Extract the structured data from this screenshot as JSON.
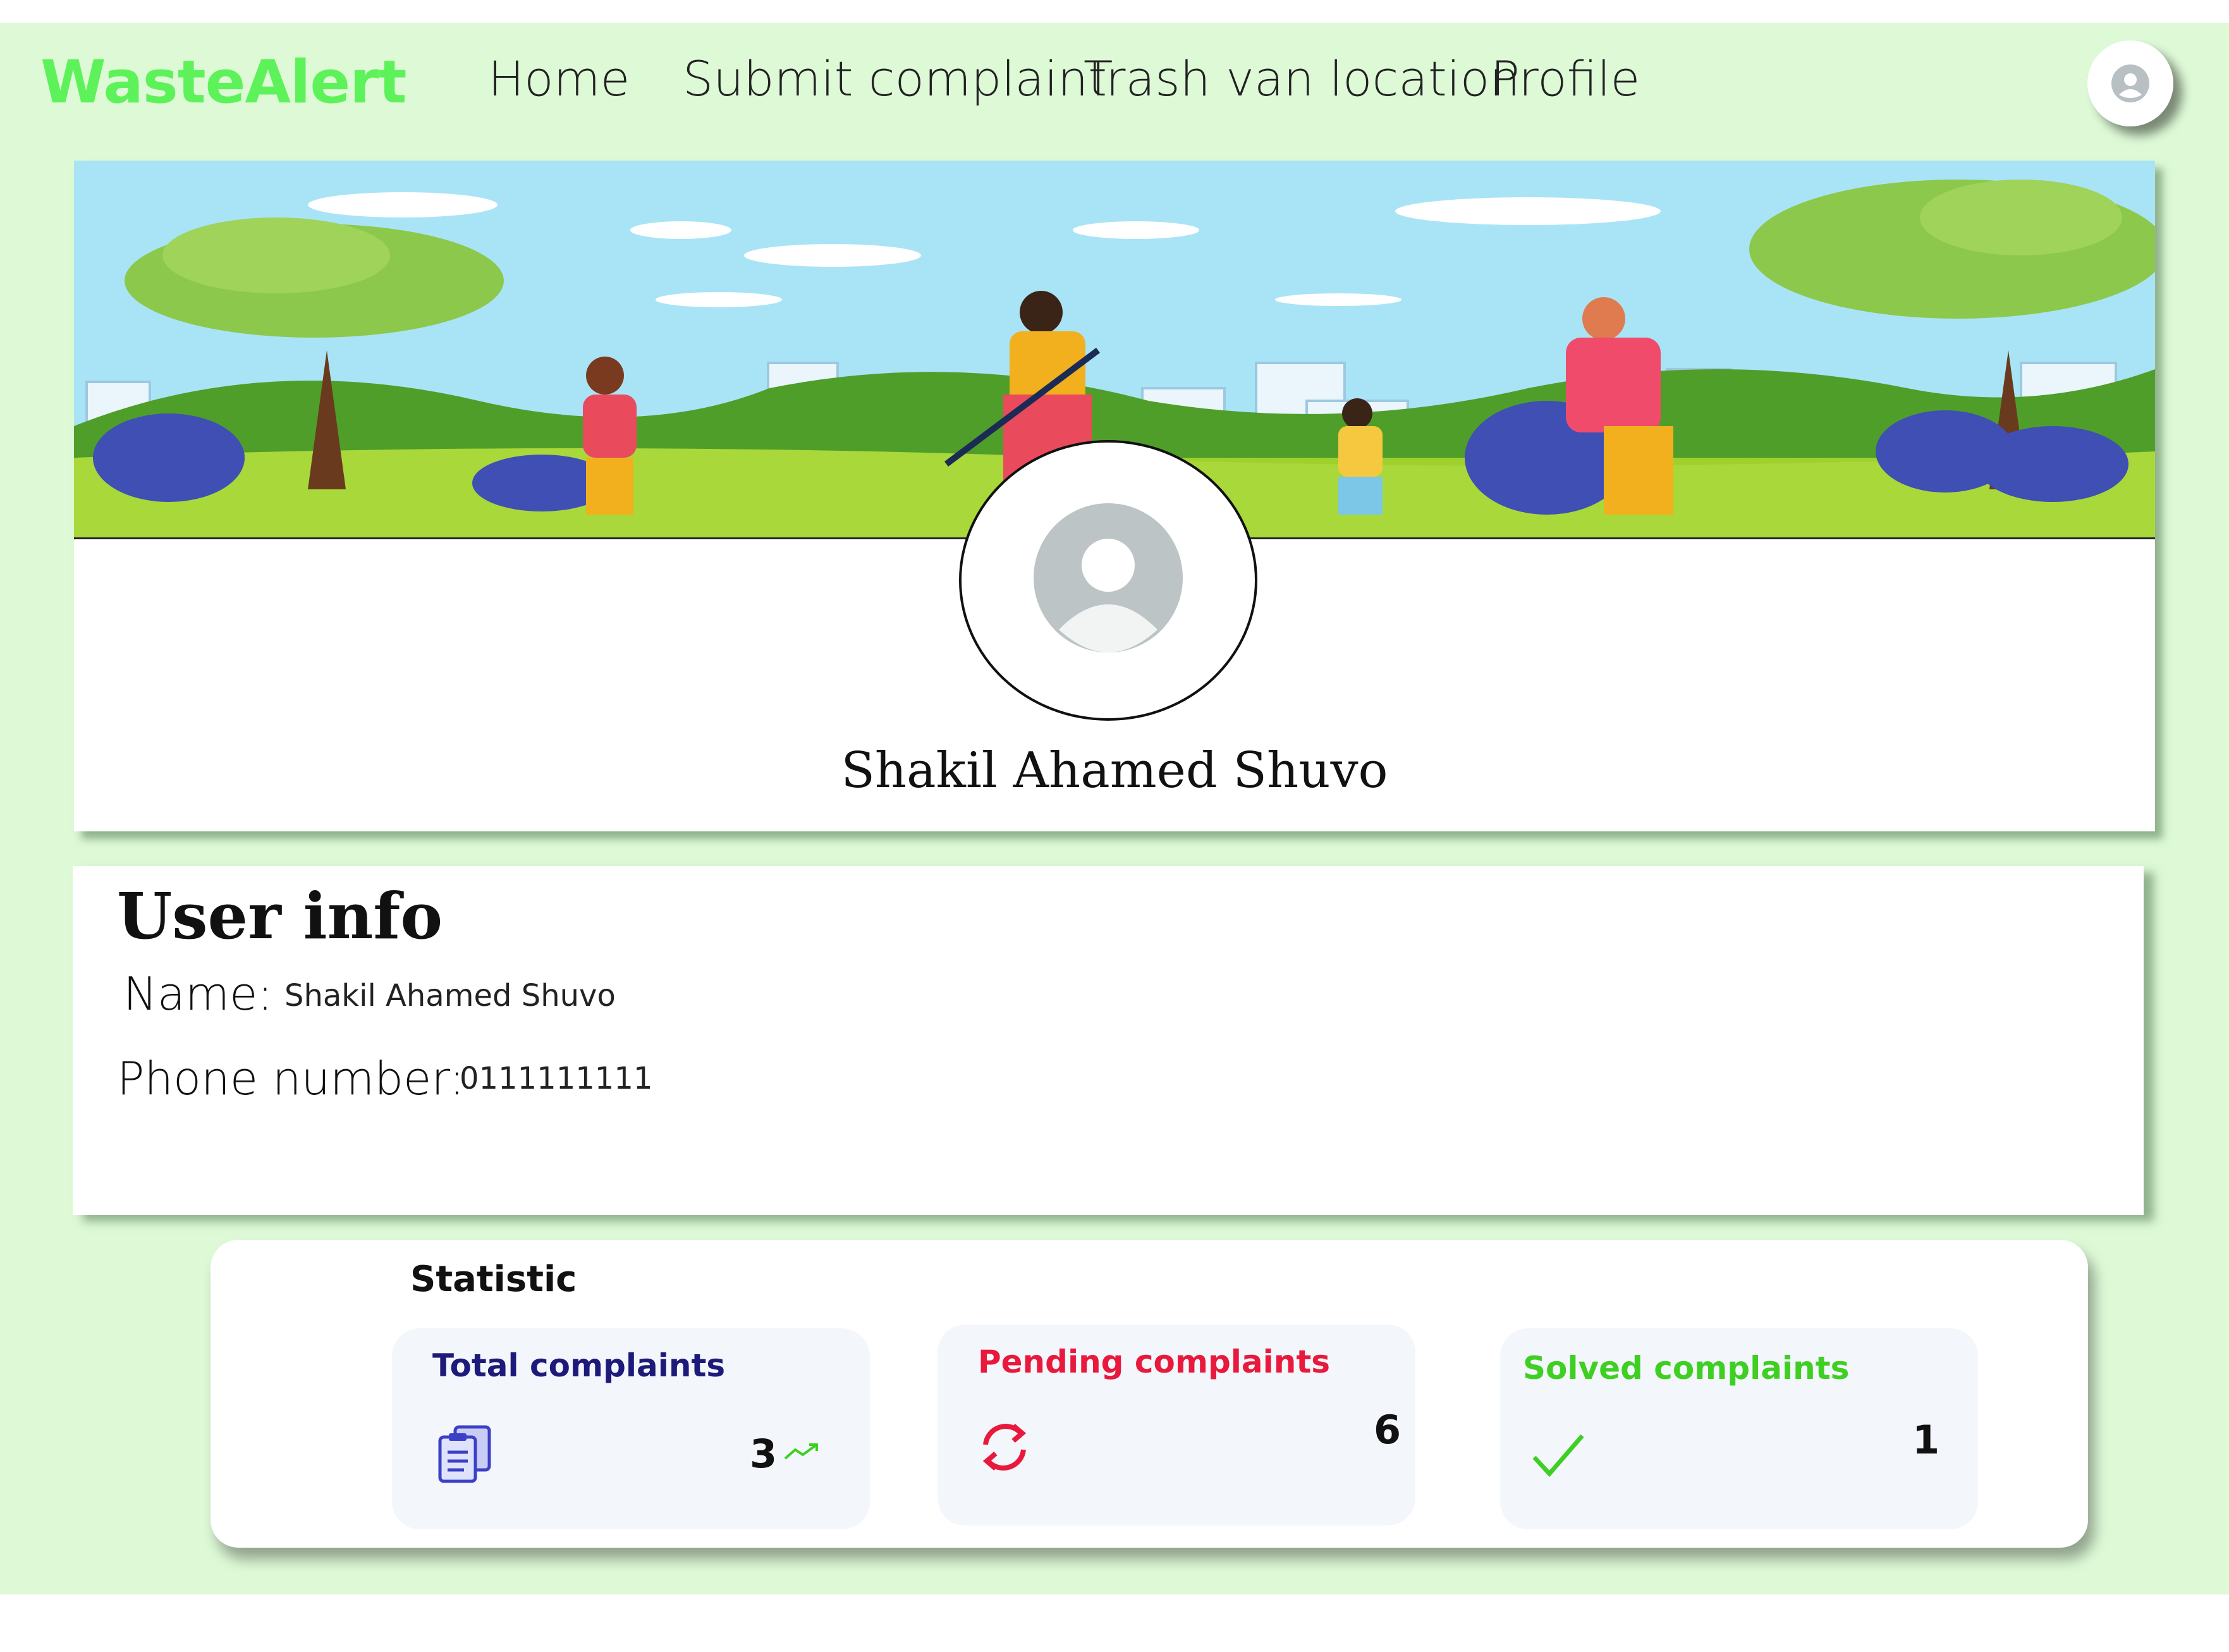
{
  "header": {
    "brand": "WasteAlert",
    "nav": [
      {
        "label": "Home"
      },
      {
        "label": "Submit complaint"
      },
      {
        "label": "Trash van location"
      },
      {
        "label": "Profile"
      }
    ],
    "user_avatar_icon": "user-avatar-icon"
  },
  "profile": {
    "banner_icon": "community-cleanup-illustration",
    "avatar_icon": "default-avatar-icon",
    "name": "Shakil Ahamed Shuvo"
  },
  "user_info": {
    "title": "User info",
    "name_label": "Name:",
    "name_value": "Shakil Ahamed Shuvo",
    "phone_label": "Phone number:",
    "phone_value": "0111111111"
  },
  "statistic": {
    "title": "Statistic",
    "cards": [
      {
        "label": "Total complaints",
        "count": "3",
        "icon": "clipboard-icon",
        "trend_icon": "trending-up-icon",
        "color": "#1d1a7a"
      },
      {
        "label": "Pending complaints",
        "count": "6",
        "icon": "refresh-icon",
        "color": "#e8193c"
      },
      {
        "label": "Solved complaints",
        "count": "1",
        "icon": "check-icon",
        "color": "#3fcf23"
      }
    ]
  },
  "colors": {
    "background": "#ddf9d6",
    "brand": "#5ef25a",
    "total": "#1d1a7a",
    "pending": "#e8193c",
    "solved": "#3fcf23"
  }
}
